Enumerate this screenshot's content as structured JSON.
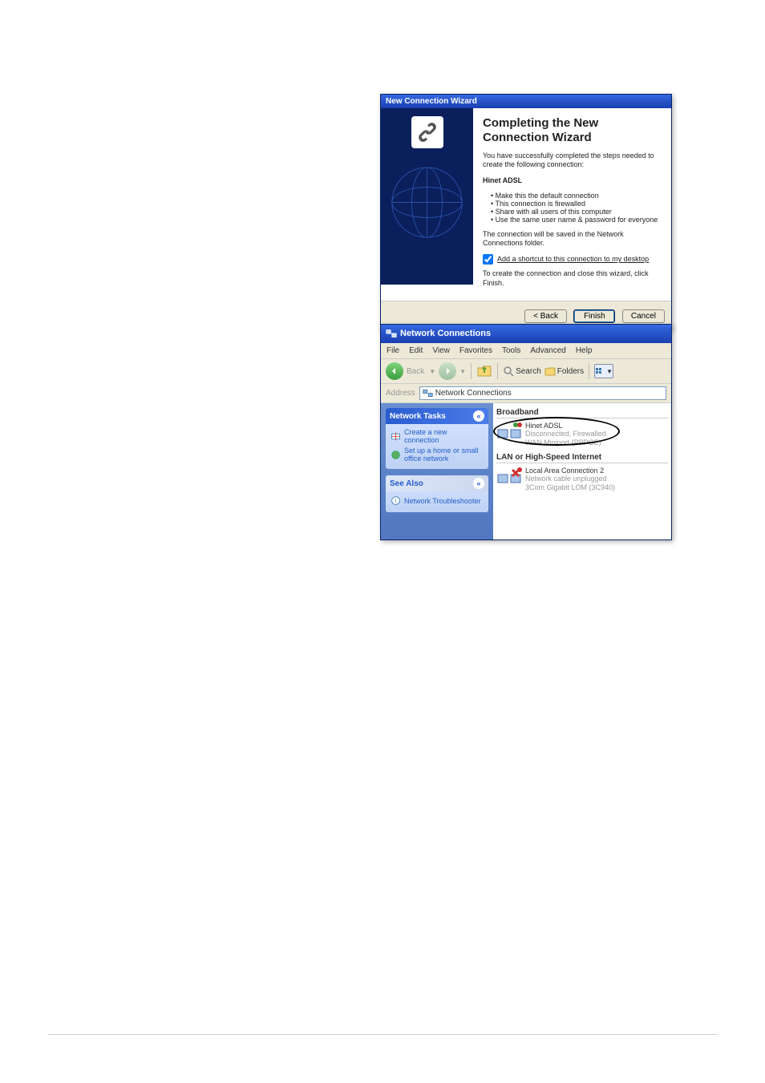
{
  "wizard": {
    "title": "New Connection Wizard",
    "heading": "Completing the New Connection Wizard",
    "intro": "You have successfully completed the steps needed to create the following connection:",
    "connection_name": "Hinet ADSL",
    "bullets": [
      "Make this the default connection",
      "This connection is firewalled",
      "Share with all users of this computer",
      "Use the same user name & password for everyone"
    ],
    "saved_note": "The connection will be saved in the Network Connections folder.",
    "shortcut_label": "Add a shortcut to this connection to my desktop",
    "close_note": "To create the connection and close this wizard, click Finish.",
    "buttons": {
      "back": "< Back",
      "finish": "Finish",
      "cancel": "Cancel"
    }
  },
  "netconn": {
    "title": "Network Connections",
    "menus": [
      "File",
      "Edit",
      "View",
      "Favorites",
      "Tools",
      "Advanced",
      "Help"
    ],
    "toolbar": {
      "back": "Back",
      "search": "Search",
      "folders": "Folders"
    },
    "address_label": "Address",
    "address_value": "Network Connections",
    "tasks_panel": {
      "header": "Network Tasks",
      "links": [
        {
          "icon": "new-conn-icon",
          "label": "Create a new connection"
        },
        {
          "icon": "home-net-icon",
          "label": "Set up a home or small office network"
        }
      ]
    },
    "seealso_panel": {
      "header": "See Also",
      "links": [
        {
          "icon": "troubleshoot-icon",
          "label": "Network Troubleshooter"
        }
      ]
    },
    "groups": [
      {
        "name": "Broadband",
        "items": [
          {
            "title": "Hinet ADSL",
            "sub1": "Disconnected, Firewalled",
            "sub2": "WAN Miniport (PPPOE)",
            "highlighted": true
          }
        ]
      },
      {
        "name": "LAN or High-Speed Internet",
        "items": [
          {
            "title": "Local Area Connection 2",
            "sub1": "Network cable unplugged",
            "sub2": "3Com Gigabit LOM (3C940)",
            "highlighted": false
          }
        ]
      }
    ]
  }
}
